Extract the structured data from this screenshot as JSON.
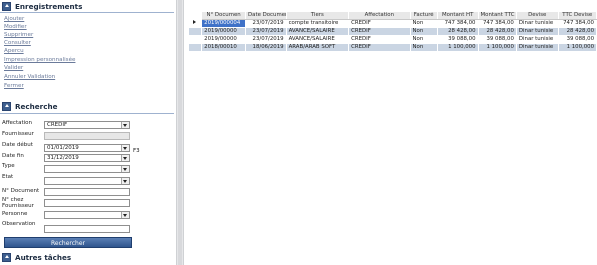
{
  "sidebar": {
    "enregistrements": {
      "title": "Enregistrements",
      "links": [
        "Ajouter",
        "Modifier",
        "Supprimer",
        "Consulter",
        "Apercu",
        "Impression personnalisée",
        "Valider",
        "Annuler Validation",
        "Fermer"
      ]
    },
    "recherche": {
      "title": "Recherche",
      "fields": {
        "affectation": {
          "label": "Affectation",
          "value": "CREDIF"
        },
        "fournisseur": {
          "label": "Fournisseur",
          "value": ""
        },
        "date_debut": {
          "label": "Date début",
          "value": "01/01/2019"
        },
        "date_fin": {
          "label": "Date fin",
          "value": "31/12/2019"
        },
        "type": {
          "label": "Type",
          "value": ""
        },
        "etat": {
          "label": "Etat",
          "value": ""
        },
        "no_document": {
          "label": "N° Document",
          "value": ""
        },
        "no_chez_fournisseur": {
          "label": "N° chez Fournisseur",
          "value": ""
        },
        "personne": {
          "label": "Personne",
          "value": ""
        },
        "observation": {
          "label": "Observation",
          "value": ""
        }
      },
      "f3_hint": "F3",
      "button": "Rechercher"
    },
    "autres": {
      "title": "Autres tâches"
    }
  },
  "grid": {
    "columns": [
      "N° Documen",
      "Date Document",
      "Tiers",
      "Affectation",
      "Facturé",
      "Montant HT",
      "Montant TTC",
      "Devise",
      "TTC Devise"
    ],
    "rows": [
      [
        "2019/000004",
        "23/07/2019",
        "compte transitoire",
        "CREDIF",
        "Non",
        "747 384,00",
        "747 384,00",
        "Dinar tunisie",
        "747 384,00"
      ],
      [
        "2019/00000",
        "23/07/2019",
        "AVANCE/SALAIRE",
        "CREDIF",
        "Non",
        "28 428,00",
        "28 428,00",
        "Dinar tunisie",
        "28 428,00"
      ],
      [
        "2019/00000",
        "23/07/2019",
        "AVANCE/SALAIRE",
        "CREDIF",
        "Non",
        "39 088,00",
        "39 088,00",
        "Dinar tunisie",
        "39 088,00"
      ],
      [
        "2018/00010",
        "18/06/2019",
        "ARAB/ARAB SOFT",
        "CREDIF",
        "Non",
        "1 100,000",
        "1 100,000",
        "Dinar tunisie",
        "1 100,000"
      ]
    ]
  },
  "colors": {
    "accent": "#3e5f8f",
    "selected": "#3f72c8",
    "row_alt": "#cad5e3"
  }
}
